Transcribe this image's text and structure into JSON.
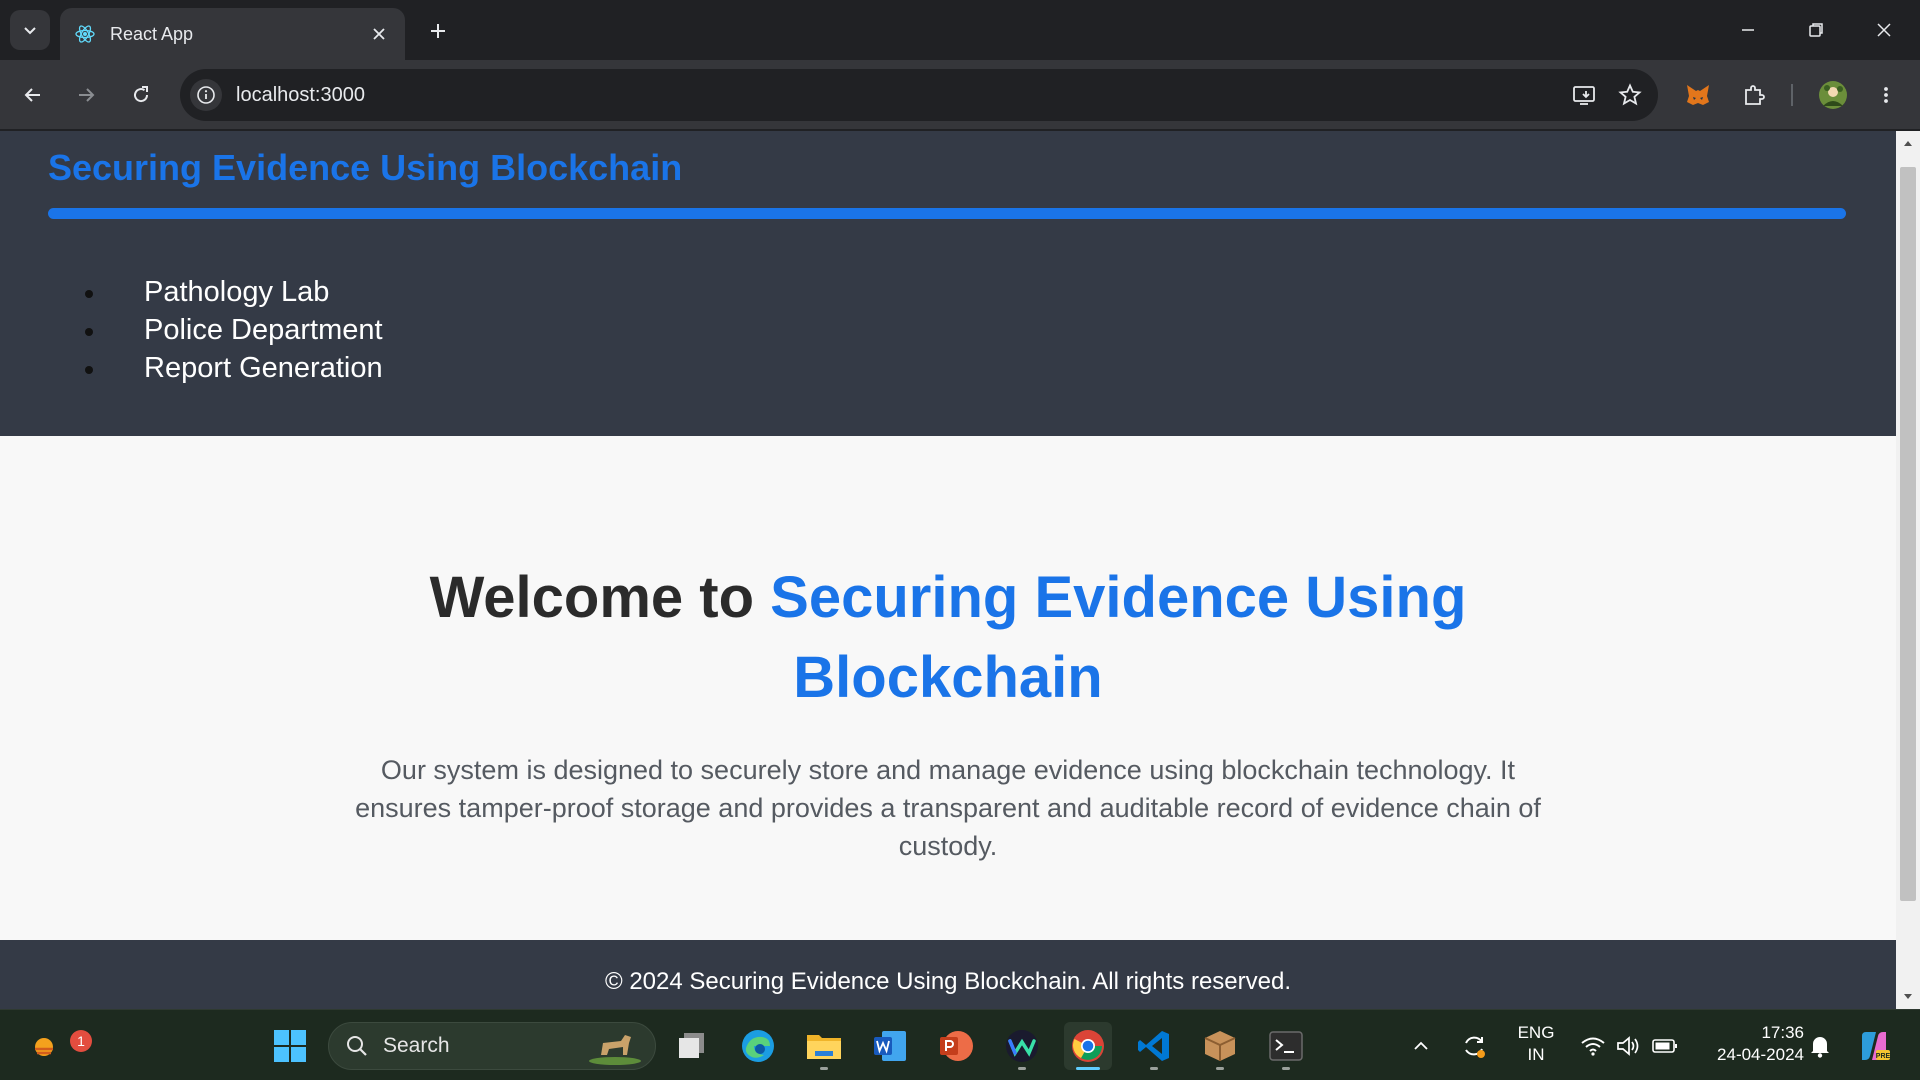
{
  "browser": {
    "tab_title": "React App",
    "url": "localhost:3000"
  },
  "page": {
    "site_title": "Securing Evidence Using Blockchain",
    "nav_items": [
      "Pathology Lab",
      "Police Department",
      "Report Generation"
    ],
    "hero_title_prefix": "Welcome to ",
    "hero_title_accent": "Securing Evidence Using Blockchain",
    "hero_description": "Our system is designed to securely store and manage evidence using blockchain technology. It ensures tamper-proof storage and provides a transparent and auditable record of evidence chain of custody.",
    "footer_text": "© 2024 Securing Evidence Using Blockchain. All rights reserved.",
    "accent_color": "#1a74e8",
    "header_bg": "#343a46"
  },
  "taskbar": {
    "search_label": "Search",
    "weather_badge": "1",
    "lang_line1": "ENG",
    "lang_line2": "IN",
    "time": "17:36",
    "date": "24-04-2024"
  }
}
